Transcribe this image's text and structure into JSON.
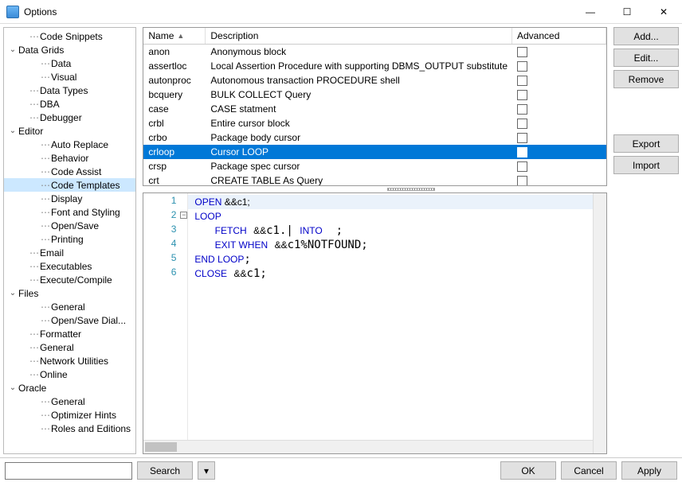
{
  "window": {
    "title": "Options"
  },
  "tree": [
    {
      "label": "Code Snippets",
      "depth": 2,
      "dots": true
    },
    {
      "label": "Data Grids",
      "depth": 1,
      "expander": "v"
    },
    {
      "label": "Data",
      "depth": 3,
      "dots": true
    },
    {
      "label": "Visual",
      "depth": 3,
      "dots": true
    },
    {
      "label": "Data Types",
      "depth": 2,
      "dots": true
    },
    {
      "label": "DBA",
      "depth": 2,
      "dots": true
    },
    {
      "label": "Debugger",
      "depth": 2,
      "dots": true
    },
    {
      "label": "Editor",
      "depth": 1,
      "expander": "v"
    },
    {
      "label": "Auto Replace",
      "depth": 3,
      "dots": true
    },
    {
      "label": "Behavior",
      "depth": 3,
      "dots": true
    },
    {
      "label": "Code Assist",
      "depth": 3,
      "dots": true
    },
    {
      "label": "Code Templates",
      "depth": 3,
      "dots": true,
      "selected": true
    },
    {
      "label": "Display",
      "depth": 3,
      "dots": true
    },
    {
      "label": "Font and Styling",
      "depth": 3,
      "dots": true
    },
    {
      "label": "Open/Save",
      "depth": 3,
      "dots": true
    },
    {
      "label": "Printing",
      "depth": 3,
      "dots": true
    },
    {
      "label": "Email",
      "depth": 2,
      "dots": true
    },
    {
      "label": "Executables",
      "depth": 2,
      "dots": true
    },
    {
      "label": "Execute/Compile",
      "depth": 2,
      "dots": true
    },
    {
      "label": "Files",
      "depth": 1,
      "expander": "v"
    },
    {
      "label": "General",
      "depth": 3,
      "dots": true
    },
    {
      "label": "Open/Save Dial...",
      "depth": 3,
      "dots": true
    },
    {
      "label": "Formatter",
      "depth": 2,
      "dots": true
    },
    {
      "label": "General",
      "depth": 2,
      "dots": true
    },
    {
      "label": "Network Utilities",
      "depth": 2,
      "dots": true
    },
    {
      "label": "Online",
      "depth": 2,
      "dots": true
    },
    {
      "label": "Oracle",
      "depth": 1,
      "expander": "v"
    },
    {
      "label": "General",
      "depth": 3,
      "dots": true
    },
    {
      "label": "Optimizer Hints",
      "depth": 3,
      "dots": true
    },
    {
      "label": "Roles and Editions",
      "depth": 3,
      "dots": true
    }
  ],
  "grid": {
    "headers": {
      "name": "Name",
      "description": "Description",
      "advanced": "Advanced"
    },
    "rows": [
      {
        "name": "anon",
        "desc": "Anonymous block"
      },
      {
        "name": "assertloc",
        "desc": "Local Assertion Procedure with supporting DBMS_OUTPUT substitute"
      },
      {
        "name": "autonproc",
        "desc": "Autonomous transaction PROCEDURE shell"
      },
      {
        "name": "bcquery",
        "desc": "BULK COLLECT Query"
      },
      {
        "name": "case",
        "desc": "CASE statment"
      },
      {
        "name": "crbl",
        "desc": "Entire cursor block"
      },
      {
        "name": "crbo",
        "desc": "Package body cursor"
      },
      {
        "name": "crloop",
        "desc": "Cursor LOOP",
        "selected": true
      },
      {
        "name": "crsp",
        "desc": "Package spec cursor"
      },
      {
        "name": "crt",
        "desc": "CREATE TABLE As Query"
      }
    ]
  },
  "buttons": {
    "add": "Add...",
    "edit": "Edit...",
    "remove": "Remove",
    "export": "Export",
    "import": "Import",
    "search": "Search",
    "ok": "OK",
    "cancel": "Cancel",
    "apply": "Apply"
  },
  "editor": {
    "lines": [
      "1",
      "2",
      "3",
      "4",
      "5",
      "6"
    ]
  }
}
